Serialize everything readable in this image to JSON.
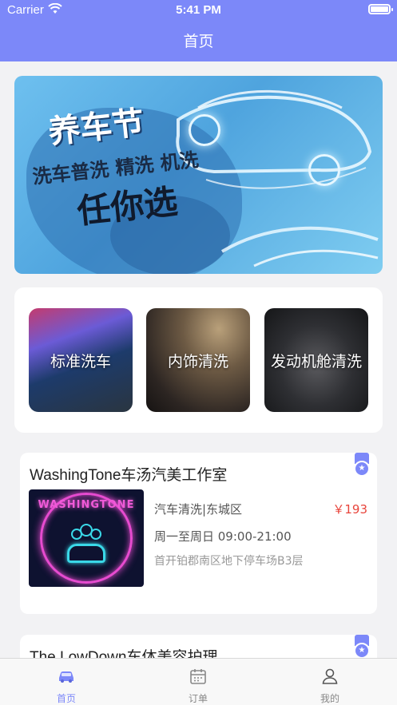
{
  "status_bar": {
    "carrier": "Carrier",
    "time": "5:41 PM"
  },
  "nav": {
    "title": "首页"
  },
  "banner": {
    "line1": "养车节",
    "line2": "洗车普洗  精洗  机洗",
    "line3": "任你选"
  },
  "categories": [
    {
      "label": "标准洗车"
    },
    {
      "label": "内饰清洗"
    },
    {
      "label": "发动机舱清洗"
    }
  ],
  "shops": [
    {
      "name": "WashingTone车汤汽美工作室",
      "logo_text": "WASHINGTONE",
      "category": "汽车清洗|东城区",
      "price": "￥193",
      "hours": "周一至周日 09:00-21:00",
      "address": "首开铂郡南区地下停车场B3层"
    },
    {
      "name": "The LowDown车体美容护理"
    }
  ],
  "tabbar": [
    {
      "label": "首页",
      "icon": "car-icon",
      "active": true
    },
    {
      "label": "订单",
      "icon": "calendar-icon",
      "active": false
    },
    {
      "label": "我的",
      "icon": "person-icon",
      "active": false
    }
  ],
  "colors": {
    "accent": "#7c88f9",
    "price": "#e8453c"
  }
}
